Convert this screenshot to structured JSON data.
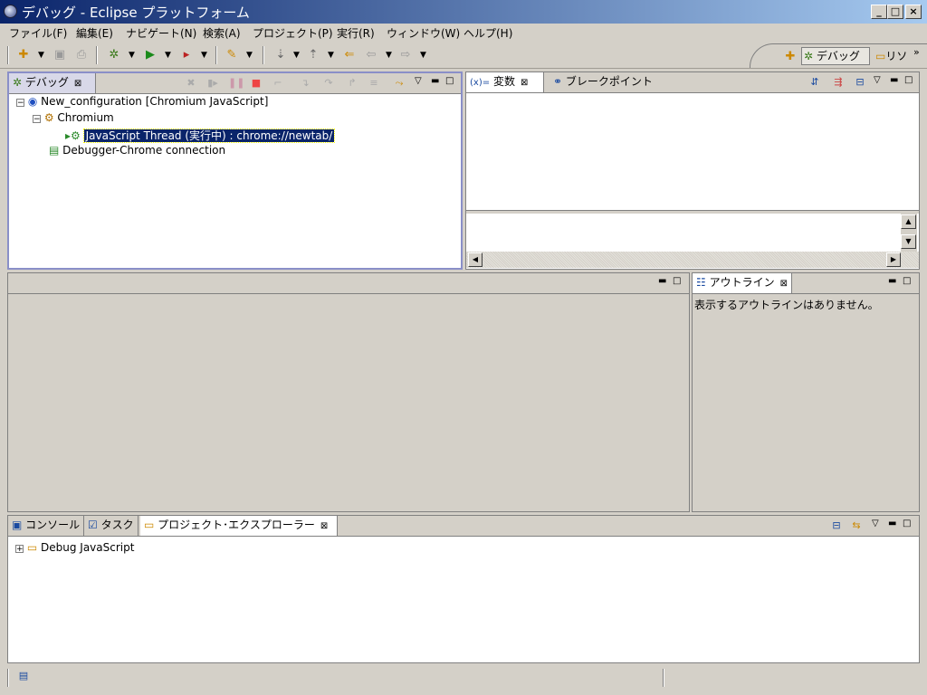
{
  "window": {
    "title": "デバッグ - Eclipse プラットフォーム"
  },
  "menu": [
    "ファイル(F)",
    "編集(E)",
    "ナビゲート(N)",
    "検索(A)",
    "プロジェクト(P)",
    "実行(R)",
    "ウィンドウ(W)",
    "ヘルプ(H)"
  ],
  "perspectives": {
    "debug": "デバッグ",
    "resource": "リソ",
    "more": "»"
  },
  "debug_view": {
    "tab": "デバッグ",
    "tree": {
      "config": "New_configuration [Chromium JavaScript]",
      "target": "Chromium",
      "thread": "JavaScript Thread (実行中) : chrome://newtab/",
      "connection": "Debugger-Chrome connection"
    }
  },
  "variables_view": {
    "tab_variables": "変数",
    "tab_breakpoints": "ブレークポイント"
  },
  "outline_view": {
    "tab": "アウトライン",
    "message": "表示するアウトラインはありません。"
  },
  "bottom_view": {
    "tab_console": "コンソール",
    "tab_tasks": "タスク",
    "tab_explorer": "プロジェクト･エクスプローラー",
    "tree_item": "Debug JavaScript"
  },
  "colors": {
    "selection": "#0a246a",
    "title_start": "#0a246a",
    "title_end": "#a6caf0"
  }
}
